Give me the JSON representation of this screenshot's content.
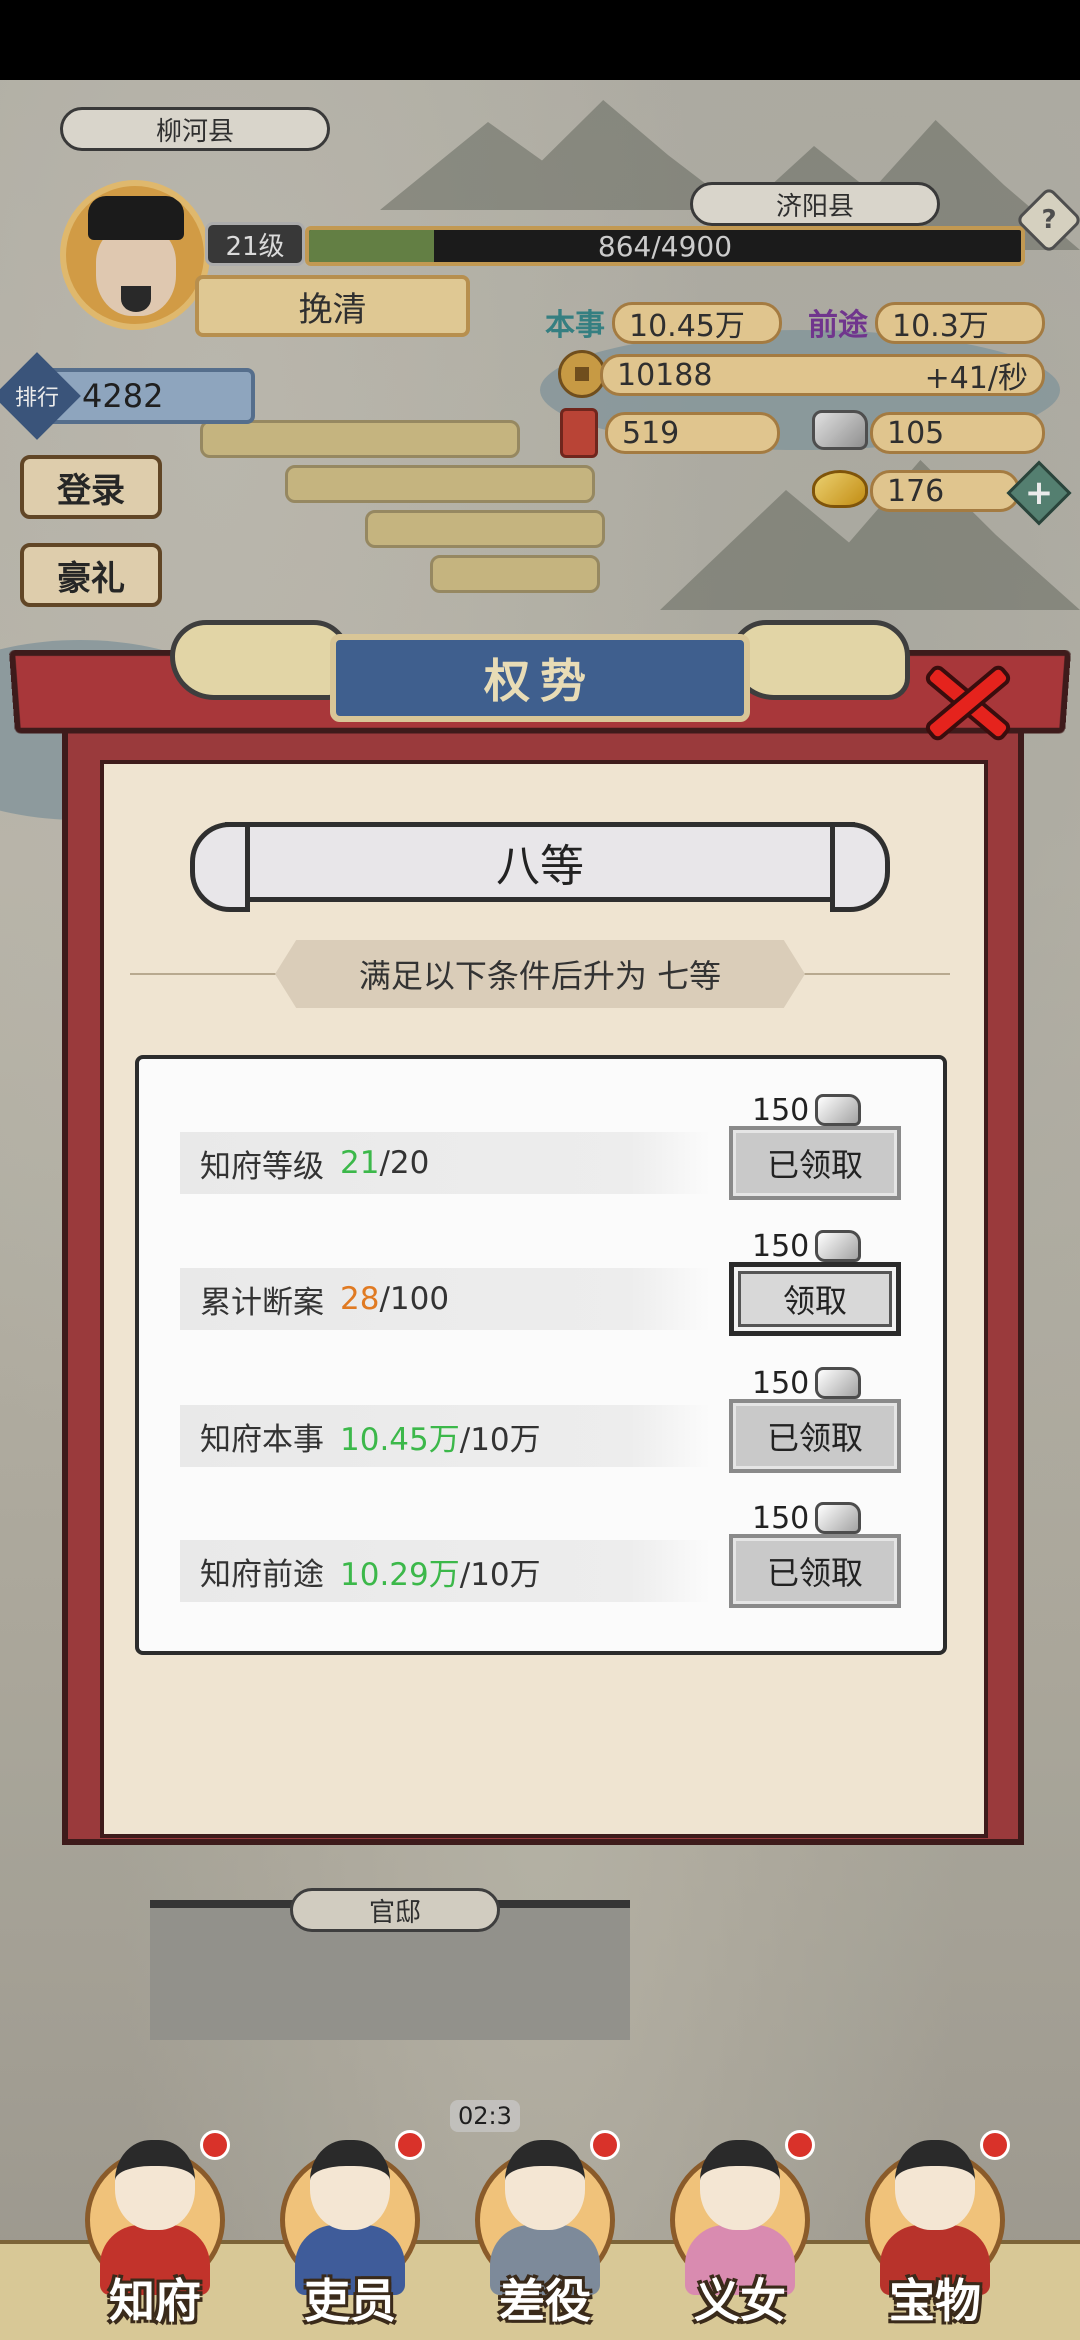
{
  "map": {
    "place_top_left": "柳河县",
    "place_top_right": "济阳县",
    "building_sign": "官邸",
    "timer": "02:3"
  },
  "player": {
    "level": "21级",
    "exp_text": "864/4900",
    "exp_fraction": 0.176,
    "name": "挽清"
  },
  "stats": {
    "benshi_label": "本事",
    "benshi_value": "10.45万",
    "qiantu_label": "前途",
    "qiantu_value": "10.3万",
    "coins": "10188",
    "coins_rate": "+41/秒",
    "scrolls": "519",
    "silver": "105",
    "gold": "176"
  },
  "rank": {
    "label": "排行",
    "value": "4282"
  },
  "side_buttons": [
    "登录",
    "豪礼"
  ],
  "modal": {
    "title": "权势",
    "grade": "八等",
    "condition": "满足以下条件后升为 七等",
    "tasks": [
      {
        "label": "知府等级",
        "current": "21",
        "target": "/20",
        "color": "green",
        "reward": "150",
        "button": "已领取",
        "active": false
      },
      {
        "label": "累计断案",
        "current": "28",
        "target": "/100",
        "color": "orange",
        "reward": "150",
        "button": "领取",
        "active": true
      },
      {
        "label": "知府本事",
        "current": "10.45万",
        "target": "/10万",
        "color": "green",
        "reward": "150",
        "button": "已领取",
        "active": false
      },
      {
        "label": "知府前途",
        "current": "10.29万",
        "target": "/10万",
        "color": "green",
        "reward": "150",
        "button": "已领取",
        "active": false
      }
    ]
  },
  "nav": [
    {
      "label": "知府",
      "body_color": "#c2332b"
    },
    {
      "label": "吏员",
      "body_color": "#3f5c9a"
    },
    {
      "label": "差役",
      "body_color": "#7d8a9a"
    },
    {
      "label": "义女",
      "body_color": "#d98bb0"
    },
    {
      "label": "宝物",
      "body_color": "#b8332b"
    }
  ],
  "colors": {
    "accent_red": "#9a3a3c",
    "title_blue": "#3f5f8e",
    "green_value": "#3cb84a",
    "orange_value": "#e07a22"
  }
}
